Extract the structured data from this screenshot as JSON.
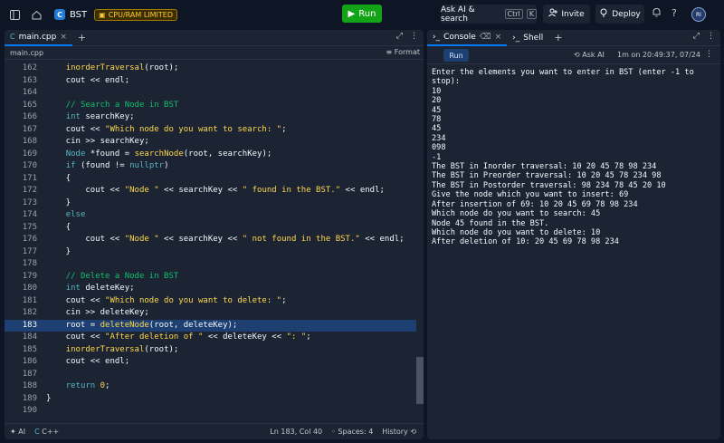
{
  "topbar": {
    "repl_name": "BST",
    "limit_badge": "CPU/RAM LIMITED",
    "run_label": "Run",
    "ask_ai_label": "Ask AI & search",
    "shortcut_ctrl": "Ctrl",
    "shortcut_key": "K",
    "invite_label": "Invite",
    "deploy_label": "Deploy",
    "avatar_initials": "RI"
  },
  "editor": {
    "tab_label": "main.cpp",
    "file_label": "main.cpp",
    "format_label": "Format",
    "highlighted_line": "183",
    "lines": [
      {
        "n": "162",
        "html": "    <span class=\"c-fn\">inorderTraversal</span>(root);"
      },
      {
        "n": "163",
        "html": "    cout &lt;&lt; endl;"
      },
      {
        "n": "164",
        "html": ""
      },
      {
        "n": "165",
        "html": "    <span class=\"c-cm\">// Search a Node in BST</span>"
      },
      {
        "n": "166",
        "html": "    <span class=\"c-type\">int</span> searchKey;"
      },
      {
        "n": "167",
        "html": "    cout &lt;&lt; <span class=\"c-str\">\"Which node do you want to search: \"</span>;"
      },
      {
        "n": "168",
        "html": "    cin &gt;&gt; searchKey;"
      },
      {
        "n": "169",
        "html": "    <span class=\"c-type\">Node</span> *found = <span class=\"c-fn\">searchNode</span>(root, searchKey);"
      },
      {
        "n": "170",
        "html": "    <span class=\"c-kw\">if</span> (found != <span class=\"c-kw\">nullptr</span>)"
      },
      {
        "n": "171",
        "html": "    {"
      },
      {
        "n": "172",
        "html": "        cout &lt;&lt; <span class=\"c-str\">\"Node \"</span> &lt;&lt; searchKey &lt;&lt; <span class=\"c-str\">\" found in the BST.\"</span> &lt;&lt; endl;"
      },
      {
        "n": "173",
        "html": "    }"
      },
      {
        "n": "174",
        "html": "    <span class=\"c-kw\">else</span>"
      },
      {
        "n": "175",
        "html": "    {"
      },
      {
        "n": "176",
        "html": "        cout &lt;&lt; <span class=\"c-str\">\"Node \"</span> &lt;&lt; searchKey &lt;&lt; <span class=\"c-str\">\" not found in the BST.\"</span> &lt;&lt; endl;"
      },
      {
        "n": "177",
        "html": "    }"
      },
      {
        "n": "178",
        "html": ""
      },
      {
        "n": "179",
        "html": "    <span class=\"c-cm\">// Delete a Node in BST</span>"
      },
      {
        "n": "180",
        "html": "    <span class=\"c-type\">int</span> deleteKey;"
      },
      {
        "n": "181",
        "html": "    cout &lt;&lt; <span class=\"c-str\">\"Which node do you want to delete: \"</span>;"
      },
      {
        "n": "182",
        "html": "    cin &gt;&gt; deleteKey;"
      },
      {
        "n": "183",
        "html": "    root = <span class=\"c-fn\">deleteNode</span>(root, deleteKey);"
      },
      {
        "n": "184",
        "html": "    cout &lt;&lt; <span class=\"c-str\">\"After deletion of \"</span> &lt;&lt; deleteKey &lt;&lt; <span class=\"c-str\">\": \"</span>;"
      },
      {
        "n": "185",
        "html": "    <span class=\"c-fn\">inorderTraversal</span>(root);"
      },
      {
        "n": "186",
        "html": "    cout &lt;&lt; endl;"
      },
      {
        "n": "187",
        "html": ""
      },
      {
        "n": "188",
        "html": "    <span class=\"c-kw\">return</span> <span class=\"c-num\">0</span>;"
      },
      {
        "n": "189",
        "html": "}"
      },
      {
        "n": "190",
        "html": ""
      }
    ]
  },
  "statusbar": {
    "ai_label": "AI",
    "language": "C++",
    "cursor": "Ln 183, Col 40",
    "spaces": "Spaces: 4",
    "history": "History"
  },
  "console": {
    "tab_console": "Console",
    "tab_shell": "Shell",
    "run_label": "Run",
    "ask_ai_label": "Ask AI",
    "run_time": "1m on 20:49:37, 07/24",
    "output": "Enter the elements you want to enter in BST (enter -1 to\nstop):\n10\n20\n45\n78\n45\n234\n098\n-1\nThe BST in Inorder traversal: 10 20 45 78 98 234\nThe BST in Preorder traversal: 10 20 45 78 234 98\nThe BST in Postorder traversal: 98 234 78 45 20 10\nGive the node which you want to insert: 69\nAfter insertion of 69: 10 20 45 69 78 98 234\nWhich node do you want to search: 45\nNode 45 found in the BST.\nWhich node do you want to delete: 10\nAfter deletion of 10: 20 45 69 78 98 234"
  }
}
